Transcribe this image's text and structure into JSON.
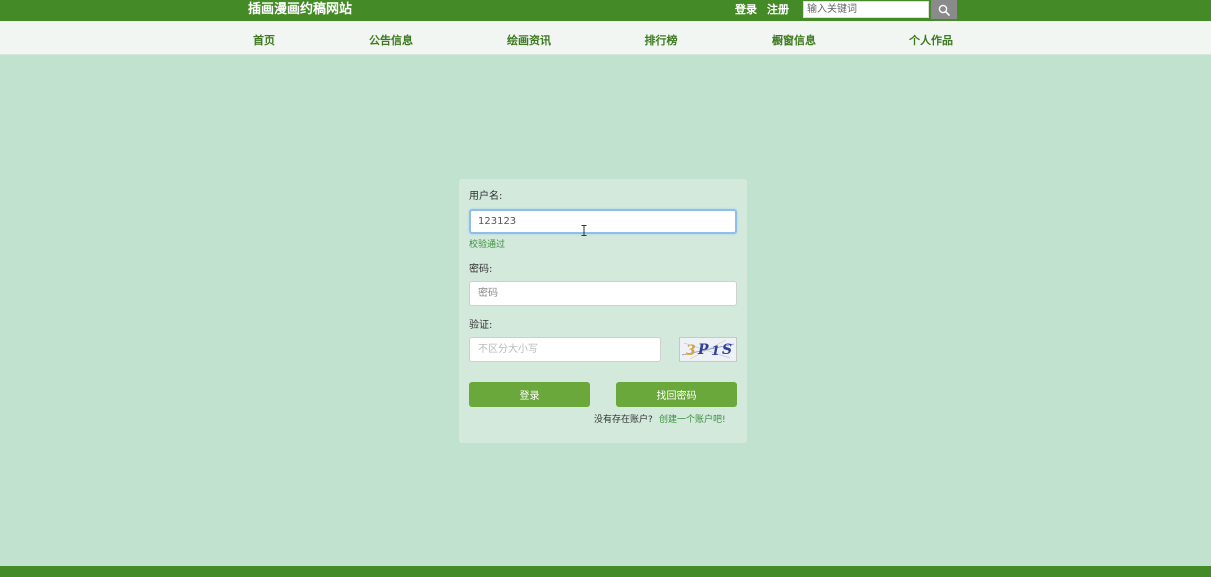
{
  "header": {
    "site_title": "插画漫画约稿网站",
    "login_link": "登录",
    "register_link": "注册",
    "search_placeholder": "输入关键词",
    "search_icon": "search-icon"
  },
  "nav": {
    "items": [
      "首页",
      "公告信息",
      "绘画资讯",
      "排行榜",
      "橱窗信息",
      "个人作品"
    ]
  },
  "login_form": {
    "username_label": "用户名:",
    "username_value": "123123",
    "username_valid_msg": "校验通过",
    "password_label": "密码:",
    "password_placeholder": "密码",
    "captcha_label": "验证:",
    "captcha_placeholder": "不区分大小写",
    "captcha_text": "3P1S",
    "login_button": "登录",
    "recover_button": "找回密码",
    "no_account_text": "没有存在账户?",
    "create_account_link": "创建一个账户吧!"
  },
  "colors": {
    "header_bg": "#448b27",
    "page_bg": "#c0e2ce",
    "button_bg": "#6aa83b",
    "nav_text": "#3f7a22"
  }
}
